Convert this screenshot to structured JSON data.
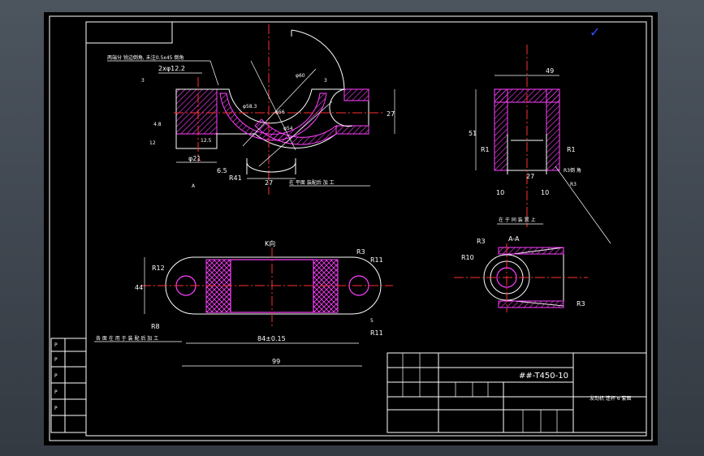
{
  "drawing": {
    "corner_mark": "✓",
    "note_top_left": "两端分 锐边倒角, 未注0.5x45 倒角",
    "section_aa_title": "A-A",
    "view_k_title": "K向",
    "title_block": {
      "part_no": "##-T450-10",
      "part_name": "发动机 连杆 6 套图"
    },
    "dims": {
      "d_2x122": "2xφ12.2",
      "d_3a": "3",
      "d_3b": "3",
      "d_48": "4.8",
      "d_125": "12.5",
      "d_12": "12",
      "d_21": "φ21",
      "d_65": "6.5",
      "r41": "R41",
      "d_27a": "27",
      "d_27b": "27",
      "d_60": "φ60",
      "d_583": "φ58.3",
      "d_56": "φ56",
      "d_54": "φ54",
      "note_plane": "在 平面 装配后 加 工",
      "d_49": "49",
      "d_51": "51",
      "r1a": "R1",
      "r1b": "R1",
      "d_27c": "27",
      "d_10a": "10",
      "d_10b": "10",
      "r3a": "R3倒 角",
      "r3b": "R3",
      "note_assembly": "在 于 同 装 置 上",
      "r12": "R12",
      "d_44": "44",
      "r8": "R8",
      "r3c": "R3",
      "r11a": "R11",
      "r11b": "R11",
      "d_5": "5",
      "d_84": "84±0.15",
      "d_99": "99",
      "note_k": "各 面 在 用 于 装 配 后 加 工",
      "r3d": "R3",
      "r10": "R10",
      "r3e": "R3",
      "r3f": "R3"
    },
    "side_table": [
      "P",
      "P",
      "P",
      "P",
      "P"
    ]
  }
}
